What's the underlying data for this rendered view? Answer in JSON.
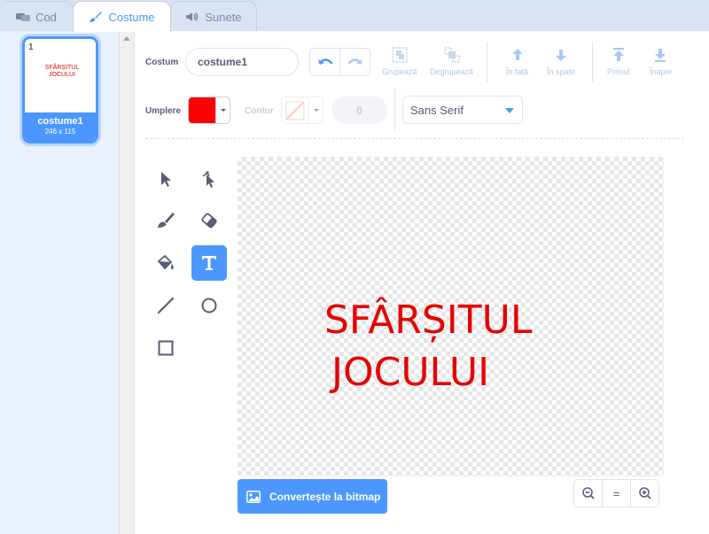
{
  "tabs": [
    {
      "label": "Cod",
      "icon": "code-icon"
    },
    {
      "label": "Costume",
      "icon": "brush-icon"
    },
    {
      "label": "Sunete",
      "icon": "speaker-icon"
    }
  ],
  "costume_list": [
    {
      "number": "1",
      "name": "costume1",
      "size": "246 x 115",
      "thumb_lines": [
        "SFÂRȘITUL",
        "JOCULUI"
      ]
    }
  ],
  "toolbar": {
    "costume_label": "Costum",
    "costume_name": "costume1",
    "group_label": "Grupează",
    "ungroup_label": "Degrupează",
    "forward_label": "În față",
    "backward_label": "În spate",
    "front_label": "Primul",
    "back_label": "Înapoi",
    "fill_label": "Umplere",
    "fill_color": "#ff0000",
    "outline_label": "Contur",
    "stroke_width": "0",
    "font": "Sans Serif"
  },
  "canvas": {
    "text_lines": [
      "SFÂRȘITUL",
      "JOCULUI"
    ],
    "text_color": "#e60000"
  },
  "bottom": {
    "bitmap_label": "Convertește la bitmap",
    "zoom_reset": "="
  }
}
